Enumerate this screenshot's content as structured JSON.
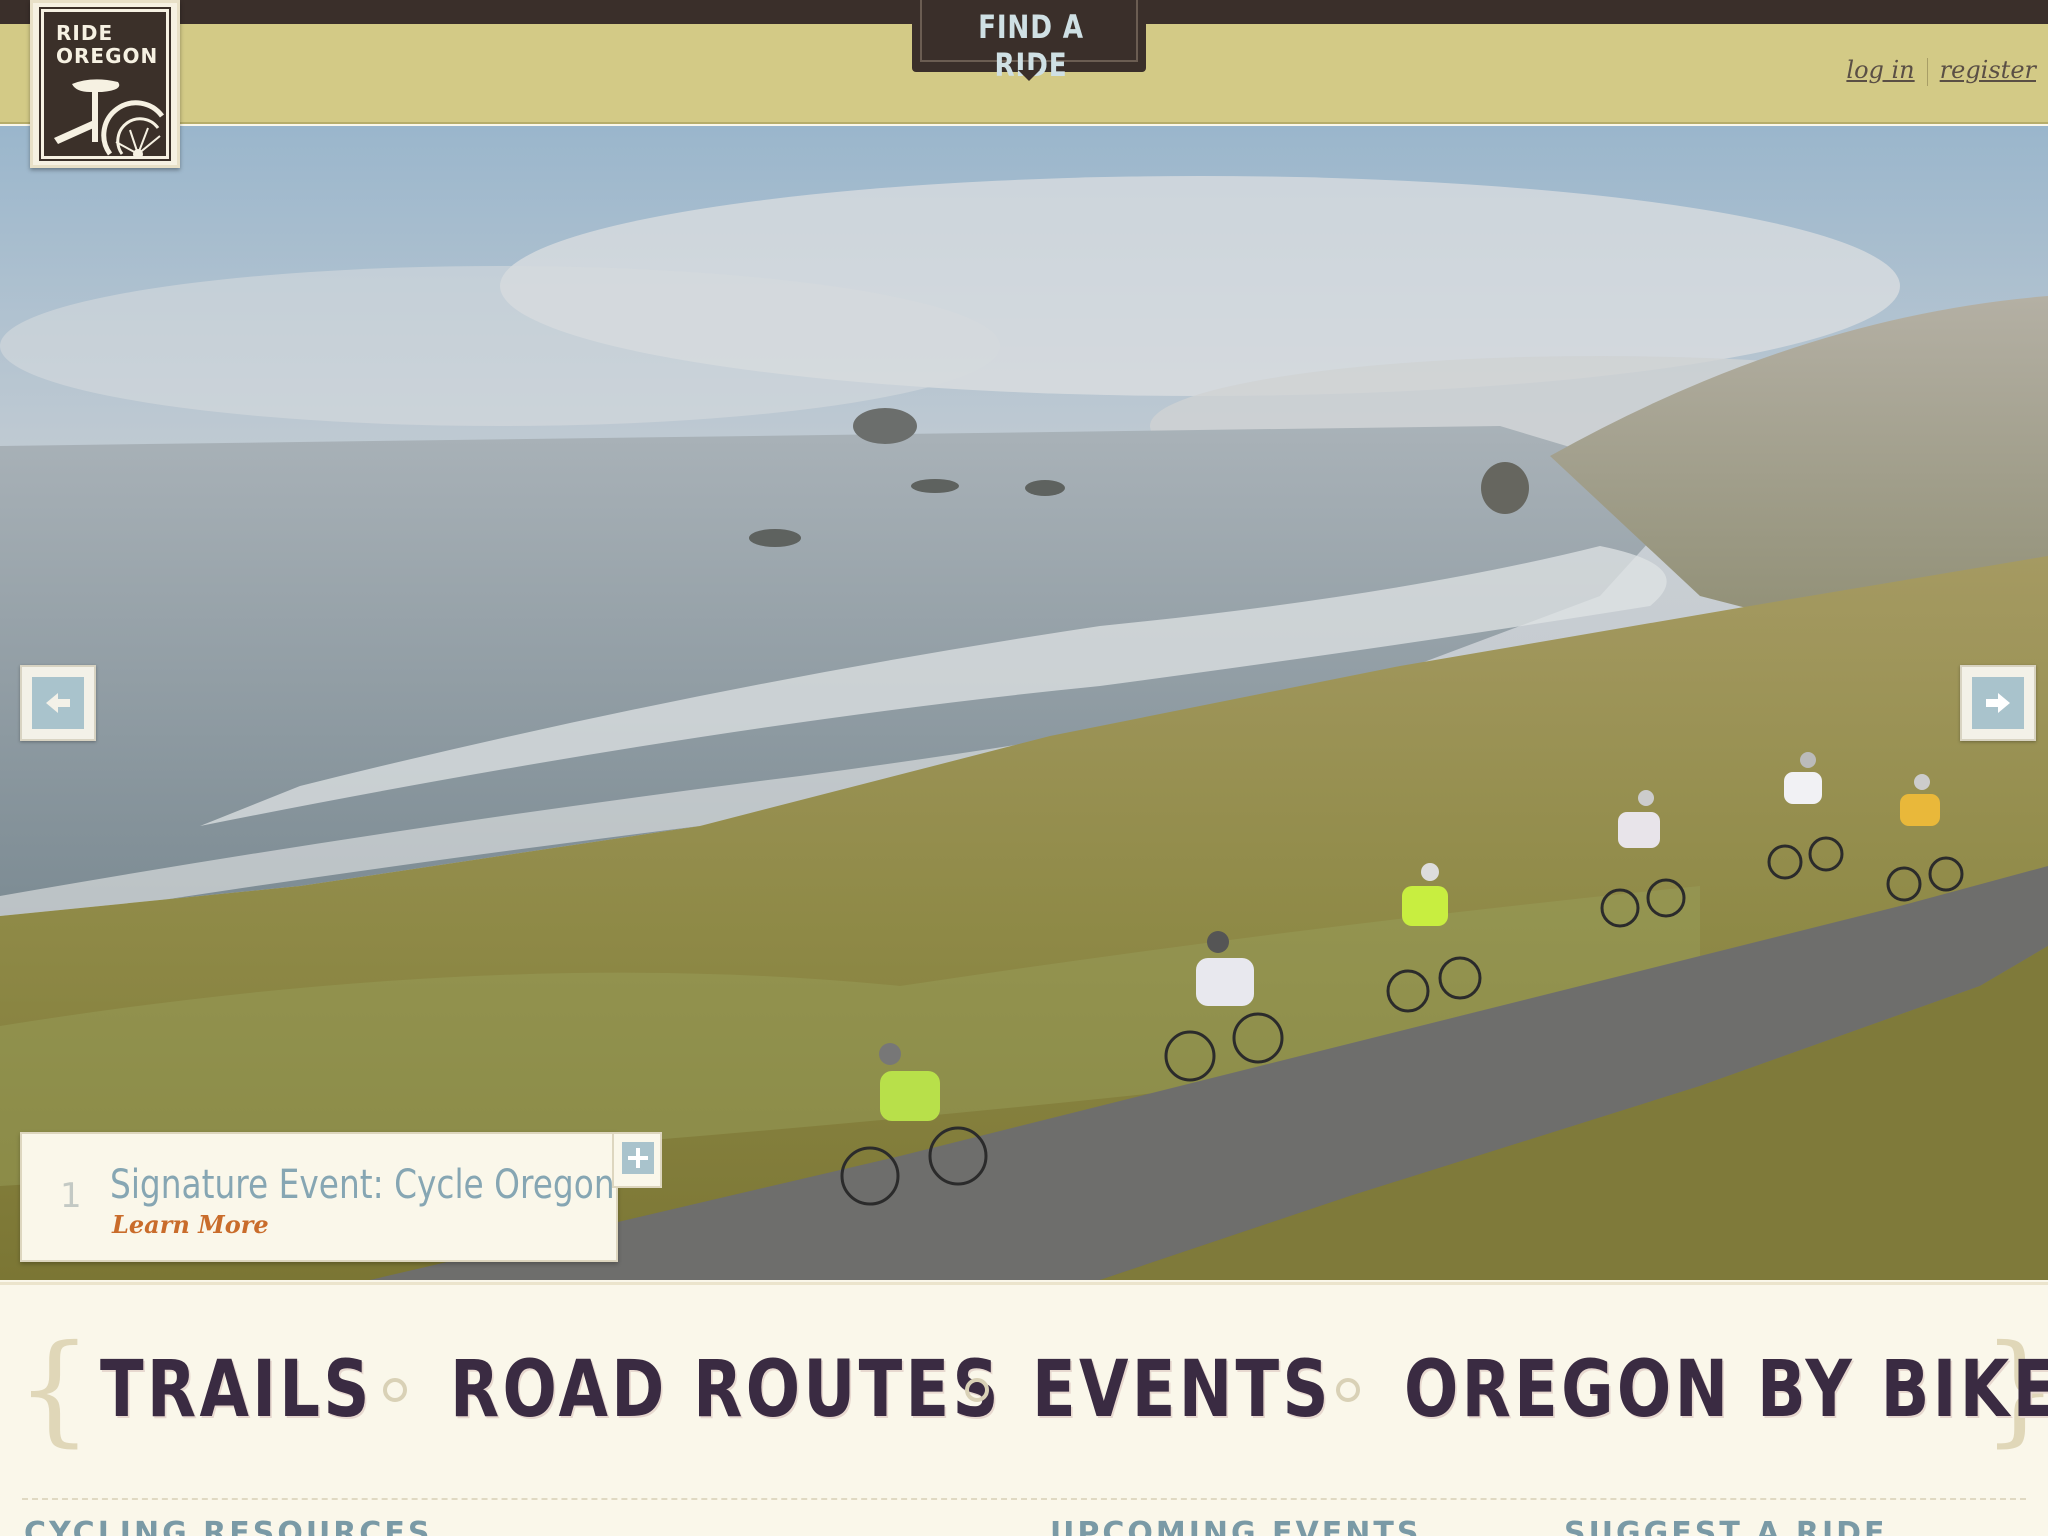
{
  "logo": {
    "line1": "RIDE",
    "line2": "OREGON"
  },
  "header": {
    "find_a_ride": "FIND A RIDE",
    "login": "log in",
    "register": "register"
  },
  "slider": {
    "slide_number": "1",
    "caption_title": "Signature Event: Cycle Oregon",
    "caption_link": "Learn More",
    "prev_icon": "arrow-left-icon",
    "next_icon": "arrow-right-icon",
    "expand_icon": "plus-icon"
  },
  "nav": {
    "items": [
      "TRAILS",
      "ROAD ROUTES",
      "EVENTS",
      "OREGON BY BIKE"
    ]
  },
  "sections": [
    "CYCLING RESOURCES",
    "UPCOMING EVENTS",
    "SUGGEST A RIDE"
  ],
  "colors": {
    "header_band": "#d3ca86",
    "dark_brown": "#3a2f2a",
    "accent_blue": "#86a6b3",
    "accent_orange": "#c96c2b",
    "nav_text": "#3a2b42"
  }
}
